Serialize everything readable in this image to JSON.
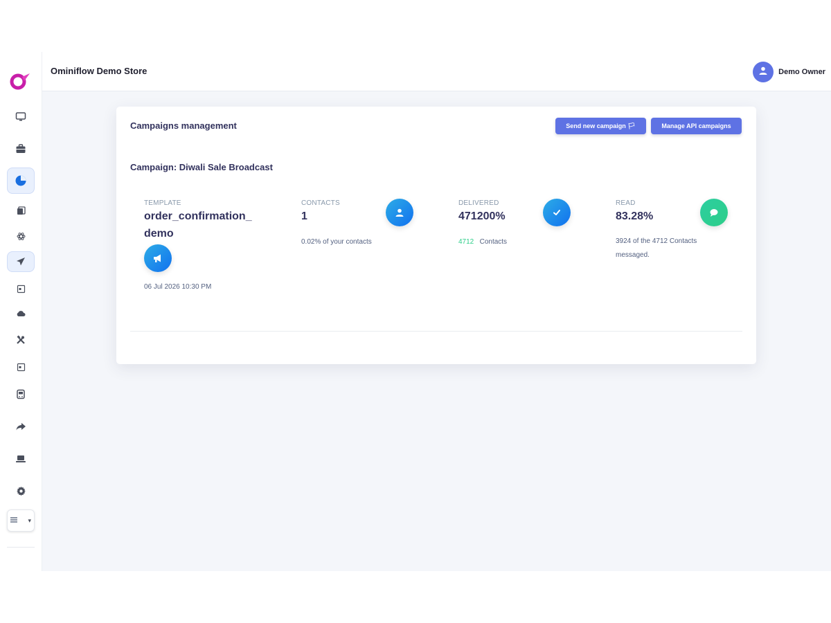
{
  "header": {
    "store_name": "Ominiflow Demo Store",
    "user_name": "Demo Owner"
  },
  "card": {
    "title": "Campaigns management",
    "send_button": "Send new campaign 🏳",
    "api_button": "Manage API campaigns",
    "campaign_title": "Campaign: Diwali Sale Broadcast"
  },
  "stats": {
    "template": {
      "label": "TEMPLATE",
      "value_line1": "order_confirmation_",
      "value_line2": "demo",
      "date": "06 Jul 2026 10:30 PM"
    },
    "contacts": {
      "label": "CONTACTS",
      "value": "1",
      "sub": "0.02% of your contacts"
    },
    "delivered": {
      "label": "DELIVERED",
      "value": "471200%",
      "count": "4712",
      "count_suffix": "Contacts"
    },
    "read": {
      "label": "READ",
      "value": "83.28%",
      "sub_line1": "3924 of the 4712 Contacts",
      "sub_line2": "messaged."
    }
  },
  "colors": {
    "primary": "#5e72e4",
    "delivered_count": "#2dce89",
    "icon_blue": "#1171ef",
    "icon_green": "#2dce89"
  },
  "icons": {
    "sidebar": [
      "monitor-icon",
      "briefcase-icon",
      "pie-chart-icon",
      "copy-icon",
      "atom-icon",
      "paper-plane-icon",
      "form-icon",
      "cloud-icon",
      "tools-icon",
      "form-icon",
      "bus-icon",
      "share-icon",
      "laptop-icon",
      "gear-icon",
      "language-select"
    ],
    "stats": [
      "megaphone-icon",
      "user-icon",
      "check-icon",
      "chat-bubble-icon"
    ]
  }
}
